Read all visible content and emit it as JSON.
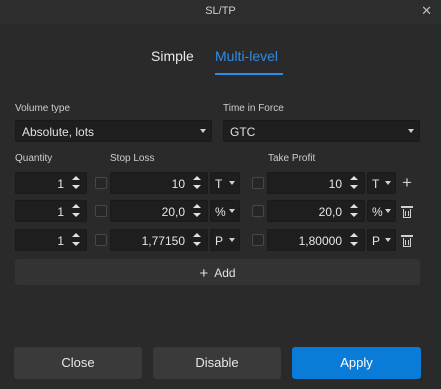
{
  "window": {
    "title": "SL/TP"
  },
  "tabs": {
    "simple": "Simple",
    "multi": "Multi-level",
    "accent": "#2f8ce6"
  },
  "volume": {
    "label": "Volume type",
    "value": "Absolute, lots"
  },
  "tif": {
    "label": "Time in Force",
    "value": "GTC"
  },
  "columns": {
    "quantity": "Quantity",
    "stop_loss": "Stop Loss",
    "take_profit": "Take Profit"
  },
  "rows": [
    {
      "qty": "1",
      "sl": "10",
      "sl_unit": "T",
      "tp": "10",
      "tp_unit": "T",
      "action_icon": "plus-icon"
    },
    {
      "qty": "1",
      "sl": "20,0",
      "sl_unit": "%",
      "tp": "20,0",
      "tp_unit": "%",
      "action_icon": "trash-icon"
    },
    {
      "qty": "1",
      "sl": "1,77150",
      "sl_unit": "P",
      "tp": "1,80000",
      "tp_unit": "P",
      "action_icon": "trash-icon"
    }
  ],
  "add_label": "Add",
  "buttons": {
    "close": "Close",
    "disable": "Disable",
    "apply": "Apply",
    "apply_color": "#0a7bd6"
  }
}
